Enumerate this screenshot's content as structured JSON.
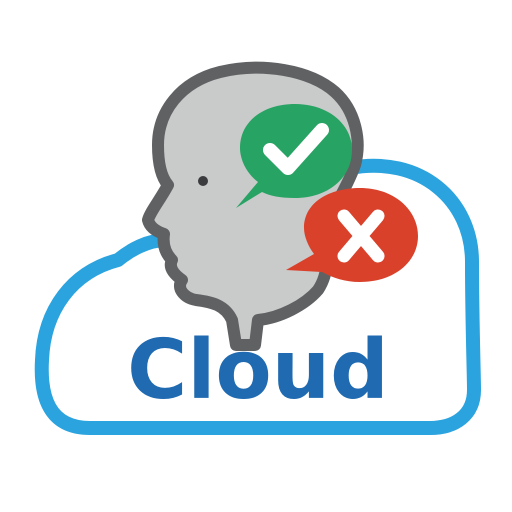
{
  "logo": {
    "text": "Cloud"
  },
  "icons": {
    "cloud": "cloud-icon",
    "head": "head-profile-icon",
    "approve": "check-speech-bubble-icon",
    "reject": "x-speech-bubble-icon"
  },
  "colors": {
    "cloud_outline": "#2aa3de",
    "cloud_fill": "#ffffff",
    "text": "#1f6ab0",
    "head_fill": "#c9caca",
    "head_outline": "#5f6163",
    "approve_bubble": "#27a363",
    "reject_bubble": "#d9412b",
    "mark": "#ffffff"
  }
}
